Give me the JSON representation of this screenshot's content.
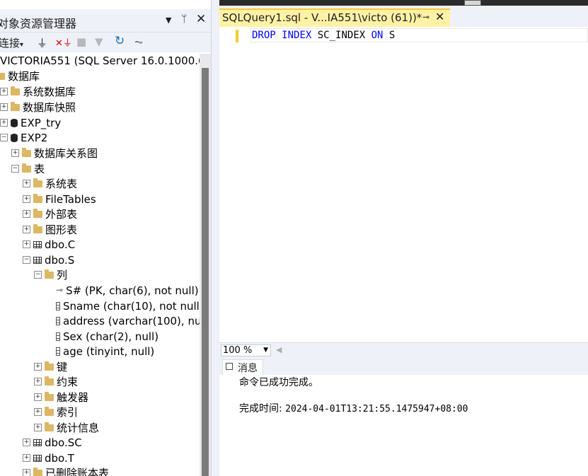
{
  "object_explorer": {
    "title": "对象资源管理器",
    "toolbar": {
      "connect_label": "连接"
    },
    "server": "VICTORIA551 (SQL Server 16.0.1000.6 -",
    "tree": [
      {
        "label": "数据库"
      },
      {
        "label": "系统数据库"
      },
      {
        "label": "数据库快照"
      },
      {
        "label": "EXP_try"
      },
      {
        "label": "EXP2"
      },
      {
        "label": "数据库关系图"
      },
      {
        "label": "表"
      },
      {
        "label": "系统表"
      },
      {
        "label": "FileTables"
      },
      {
        "label": "外部表"
      },
      {
        "label": "图形表"
      },
      {
        "label": "dbo.C"
      },
      {
        "label": "dbo.S"
      },
      {
        "label": "列"
      },
      {
        "label": "S# (PK, char(6), not null)"
      },
      {
        "label": "Sname (char(10), not null)"
      },
      {
        "label": "address (varchar(100), nu"
      },
      {
        "label": "Sex (char(2), null)"
      },
      {
        "label": "age (tinyint, null)"
      },
      {
        "label": "键"
      },
      {
        "label": "约束"
      },
      {
        "label": "触发器"
      },
      {
        "label": "索引"
      },
      {
        "label": "统计信息"
      },
      {
        "label": "dbo.SC"
      },
      {
        "label": "dbo.T"
      },
      {
        "label": "已删除账本表"
      }
    ]
  },
  "editor": {
    "tab_title": "SQLQuery1.sql - V...IA551\\victo (61))*",
    "code": {
      "kw1": "DROP",
      "kw2": "INDEX",
      "name": "SC_INDEX",
      "kw3": "ON",
      "table": "S"
    },
    "zoom": "100 %"
  },
  "results": {
    "tab_label": "消息",
    "message": "命令已成功完成。",
    "completion_label": "完成时间:",
    "completion_time": "2024-04-01T13:21:55.1475947+08:00"
  }
}
